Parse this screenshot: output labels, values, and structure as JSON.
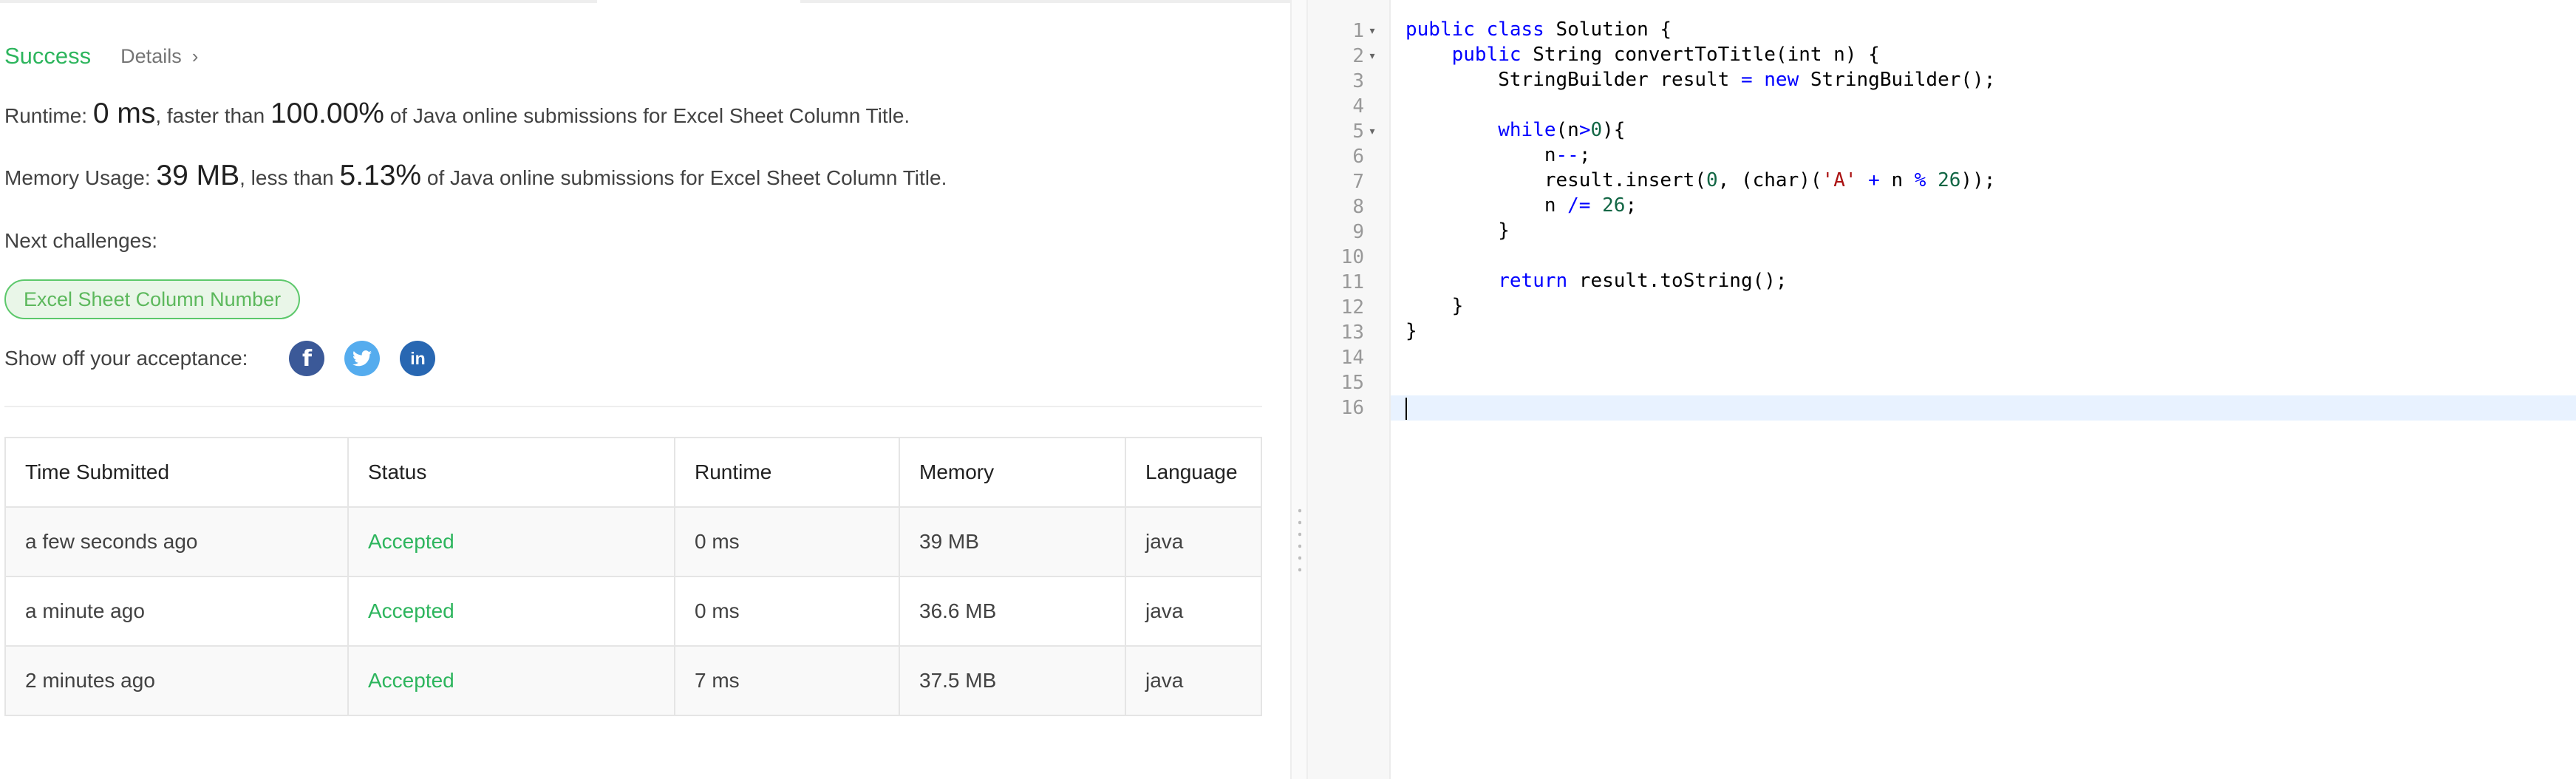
{
  "result": {
    "status": "Success",
    "details_label": "Details",
    "details_chevron": "›"
  },
  "runtime": {
    "label": "Runtime: ",
    "value": "0 ms",
    "mid": ", faster than ",
    "percent": "100.00%",
    "suffix": " of Java online submissions for Excel Sheet Column Title."
  },
  "memory": {
    "label": "Memory Usage: ",
    "value": "39 MB",
    "mid": ", less than ",
    "percent": "5.13%",
    "suffix": " of Java online submissions for Excel Sheet Column Title."
  },
  "next": {
    "label": "Next challenges:",
    "challenge": "Excel Sheet Column Number"
  },
  "share": {
    "label": "Show off your acceptance:",
    "facebook_glyph": "f",
    "twitter_glyph": "t",
    "linkedin_glyph": "in"
  },
  "table": {
    "headers": [
      "Time Submitted",
      "Status",
      "Runtime",
      "Memory",
      "Language"
    ],
    "rows": [
      [
        "a few seconds ago",
        "Accepted",
        "0 ms",
        "39 MB",
        "java"
      ],
      [
        "a minute ago",
        "Accepted",
        "0 ms",
        "36.6 MB",
        "java"
      ],
      [
        "2 minutes ago",
        "Accepted",
        "7 ms",
        "37.5 MB",
        "java"
      ]
    ]
  },
  "editor": {
    "line_numbers": [
      "1",
      "2",
      "3",
      "4",
      "5",
      "6",
      "7",
      "8",
      "9",
      "10",
      "11",
      "12",
      "13",
      "14",
      "15",
      "16"
    ],
    "fold_markers": [
      "▾",
      "▾",
      "",
      "",
      "▾",
      "",
      "",
      "",
      "",
      "",
      "",
      "",
      "",
      "",
      "",
      ""
    ],
    "lines": {
      "l1": {
        "kw1": "public class",
        "rest": " Solution {"
      },
      "l2": {
        "kw1": "public",
        "rest": " String convertToTitle(int n) {"
      },
      "l3": {
        "a": "StringBuilder result ",
        "op": "=",
        "sp": " ",
        "kw": "new",
        "b": " StringBuilder();"
      },
      "l5": {
        "kw": "while",
        "a": "(n",
        "op": ">",
        "num": "0",
        "b": "){"
      },
      "l6": {
        "a": "n",
        "op": "--",
        "b": ";"
      },
      "l7": {
        "a": "result.insert(",
        "num1": "0",
        "b": ", (char)(",
        "str": "'A'",
        "c": " ",
        "op1": "+",
        "d": " n ",
        "op2": "%",
        "e": " ",
        "num2": "26",
        "f": "));"
      },
      "l8": {
        "a": "n ",
        "op": "/=",
        "b": " ",
        "num": "26",
        "c": ";"
      },
      "l9": {
        "a": "}"
      },
      "l11": {
        "kw": "return",
        "a": " result.toString();"
      },
      "l12": {
        "a": "}"
      },
      "l13": {
        "a": "}"
      }
    }
  }
}
